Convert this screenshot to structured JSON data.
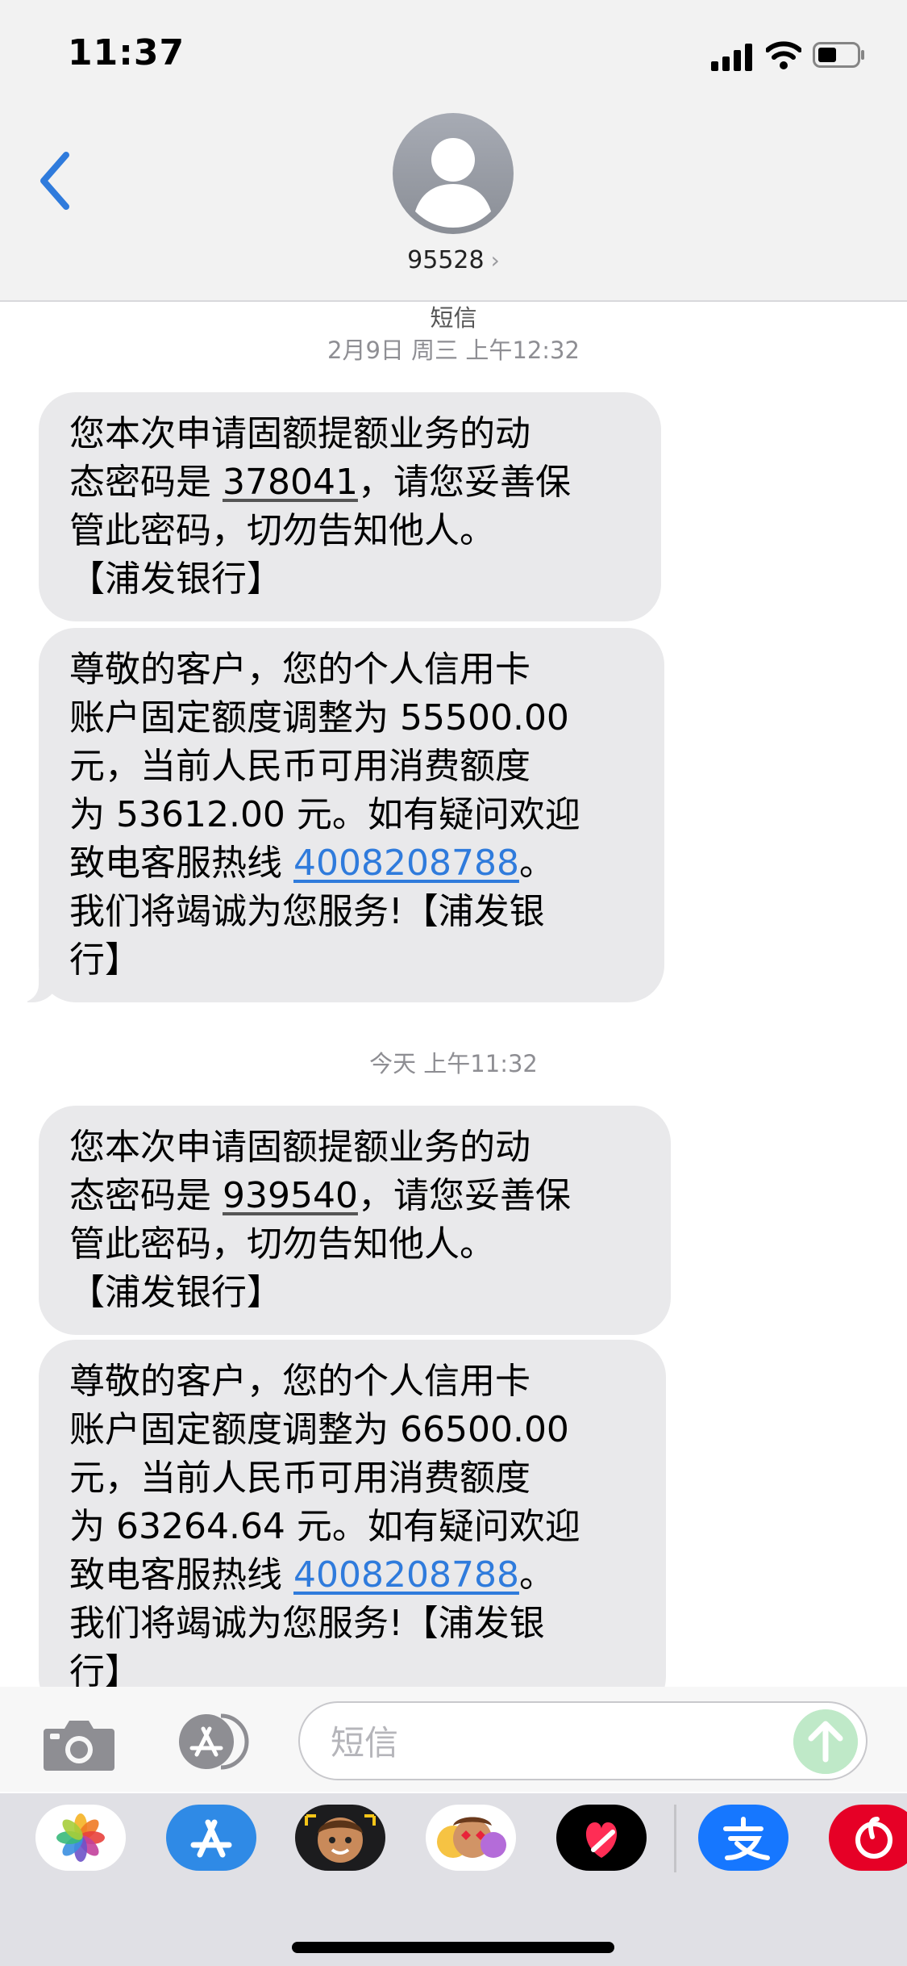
{
  "status": {
    "time": "11:37"
  },
  "header": {
    "contact": "95528",
    "chevron": "›"
  },
  "conversation": {
    "service": "短信",
    "stamp1": "2月9日 周三 上午12:32",
    "stamp2": "今天 上午11:32",
    "m1": {
      "a": "您本次申请固额提额业务的动",
      "b1": "态密码是 ",
      "code": "378041",
      "b2": "，请您妥善保",
      "c": "管此密码，切勿告知他人。",
      "d": "【浦发银行】"
    },
    "m2": {
      "a": "尊敬的客户，您的个人信用卡",
      "b": "账户固定额度调整为 55500.00",
      "c": "元，当前人民币可用消费额度",
      "d": "为 53612.00 元。如有疑问欢迎",
      "e1": "致电客服热线 ",
      "phone": "4008208788",
      "e2": "。",
      "f": "我们将竭诚为您服务!【浦发银",
      "g": "行】"
    },
    "m3": {
      "a": "您本次申请固额提额业务的动",
      "b1": "态密码是 ",
      "code": "939540",
      "b2": "，请您妥善保",
      "c": "管此密码，切勿告知他人。",
      "d": "【浦发银行】"
    },
    "m4": {
      "a": "尊敬的客户，您的个人信用卡",
      "b": "账户固定额度调整为 66500.00",
      "c": "元，当前人民币可用消费额度",
      "d": "为 63264.64 元。如有疑问欢迎",
      "e1": "致电客服热线 ",
      "phone": "4008208788",
      "e2": "。",
      "f": "我们将竭诚为您服务!【浦发银",
      "g": "行】"
    }
  },
  "input": {
    "placeholder": "短信"
  },
  "apps": {
    "photos": "photos-icon",
    "appstore": "app-store-icon",
    "memoji1": "memoji-icon",
    "memoji2": "memoji-stickers-icon",
    "digitaltouch": "digital-touch-icon",
    "alipay": "alipay-icon",
    "netease": "netease-music-icon"
  },
  "colors": {
    "bubble": "#e9e9eb",
    "link": "#2f7bdc",
    "send": "#bfe9c8",
    "back": "#2f7bdc"
  }
}
